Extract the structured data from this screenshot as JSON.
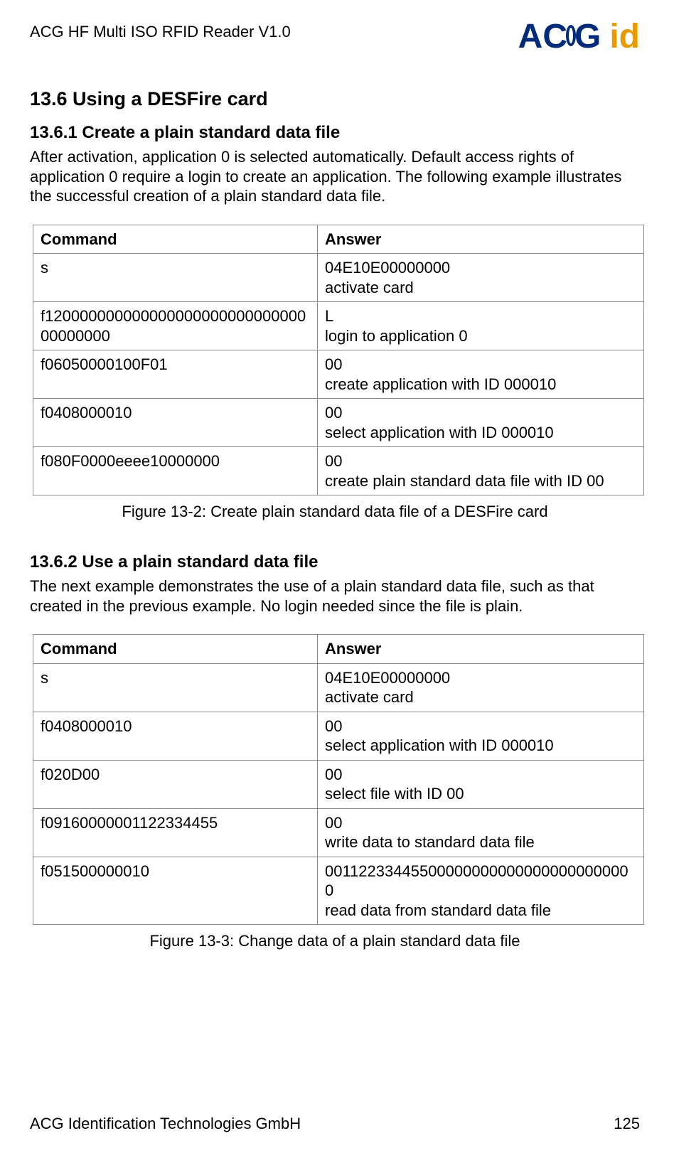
{
  "header": {
    "doc_title": "ACG HF Multi ISO RFID Reader V1.0",
    "logo_acg": "ACG",
    "logo_id": "id"
  },
  "section": {
    "title": "13.6 Using a DESFire card"
  },
  "sub1": {
    "title": "13.6.1 Create a plain standard data file",
    "para": "After activation, application 0 is selected automatically. Default access rights of application 0 require a login to create an application. The following example illustrates the successful creation of a plain standard data file.",
    "table": {
      "h_cmd": "Command",
      "h_ans": "Answer",
      "rows": [
        {
          "cmd": "s",
          "ans": "04E10E00000000\nactivate card"
        },
        {
          "cmd": "f12000000000000000000000000000000000000",
          "ans": "L\nlogin to application 0"
        },
        {
          "cmd": "f06050000100F01",
          "ans": "00\ncreate application with ID 000010"
        },
        {
          "cmd": "f0408000010",
          "ans": "00\nselect application with ID 000010"
        },
        {
          "cmd": "f080F0000eeee10000000",
          "ans": "00\ncreate plain standard data file with ID 00"
        }
      ]
    },
    "caption": "Figure 13-2: Create plain standard data file of a DESFire card"
  },
  "sub2": {
    "title": "13.6.2 Use a plain standard data file",
    "para": "The next example demonstrates the use of a plain standard data file, such as that created in the previous example. No login needed since the file is plain.",
    "table": {
      "h_cmd": "Command",
      "h_ans": "Answer",
      "rows": [
        {
          "cmd": "s",
          "ans": "04E10E00000000\nactivate card"
        },
        {
          "cmd": "f0408000010",
          "ans": "00\nselect application with ID 000010"
        },
        {
          "cmd": "f020D00",
          "ans": "00\nselect file with ID 00"
        },
        {
          "cmd": "f09160000001122334455",
          "ans": "00\nwrite data to standard data file"
        },
        {
          "cmd": "f051500000010",
          "ans": "001122334455000000000000000000000000\nread data from standard data file"
        }
      ]
    },
    "caption": "Figure 13-3: Change data of a plain standard data file"
  },
  "footer": {
    "company": "ACG Identification Technologies GmbH",
    "page": "125"
  }
}
